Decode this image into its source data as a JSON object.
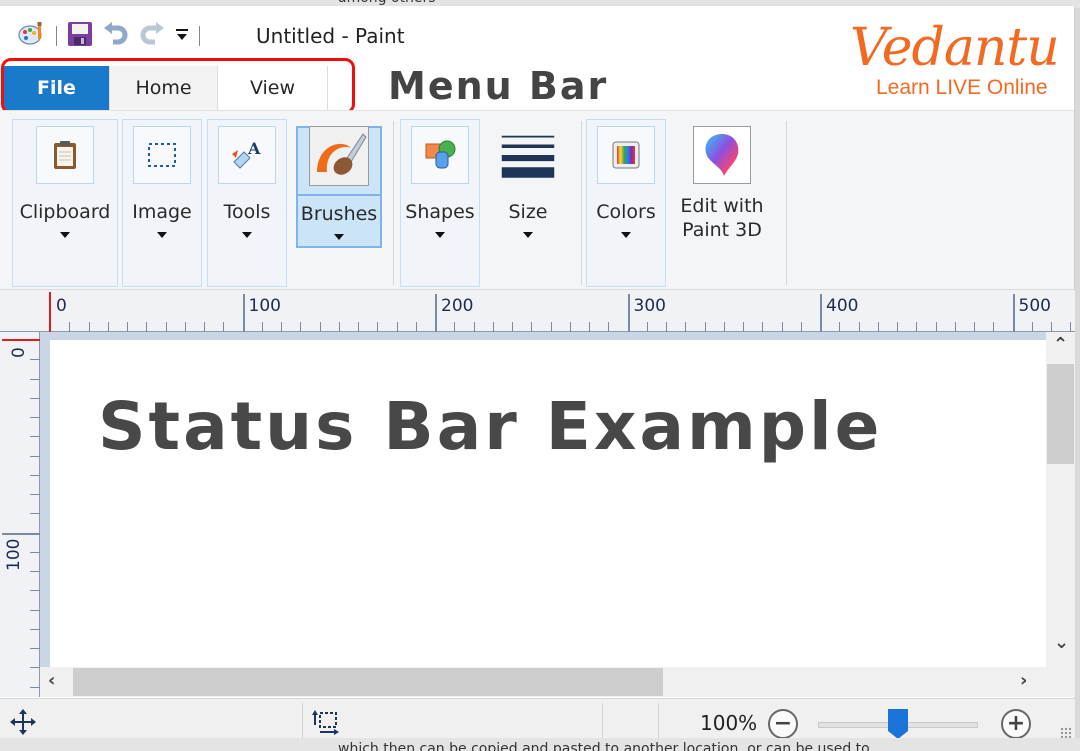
{
  "background": {
    "top_text": "among others",
    "bottom_text": "which then can be copied and pasted to another location, or can be used to"
  },
  "titlebar": {
    "title": "Untitled - Paint",
    "qat_icons": [
      "paint-app-icon",
      "save-icon",
      "undo-icon",
      "redo-icon",
      "customize-qat-icon"
    ]
  },
  "brand": {
    "logo": "Vedantu",
    "tagline": "Learn LIVE Online",
    "color": "#f26a21"
  },
  "tabs": [
    {
      "label": "File",
      "active": true
    },
    {
      "label": "Home",
      "active": false
    },
    {
      "label": "View",
      "active": false
    }
  ],
  "annotation": {
    "menu_bar_label": "Menu Bar",
    "highlight_color": "#f20d0d"
  },
  "ribbon": {
    "tools": [
      {
        "label": "Clipboard",
        "icon": "clipboard-icon",
        "dropdown": true
      },
      {
        "label": "Image",
        "icon": "select-icon",
        "dropdown": true
      },
      {
        "label": "Tools",
        "icon": "tools-icon",
        "dropdown": true
      },
      {
        "label": "Brushes",
        "icon": "brush-icon",
        "dropdown": true,
        "selected": true
      },
      {
        "label": "Shapes",
        "icon": "shapes-icon",
        "dropdown": true
      },
      {
        "label": "Size",
        "icon": "size-icon",
        "dropdown": true
      },
      {
        "label": "Colors",
        "icon": "colors-icon",
        "dropdown": true
      },
      {
        "label": "Edit with Paint 3D",
        "line1": "Edit with",
        "line2": "Paint 3D",
        "icon": "paint3d-icon",
        "dropdown": false
      }
    ]
  },
  "rulers": {
    "horizontal": [
      "0",
      "100",
      "200",
      "300",
      "400",
      "500"
    ],
    "vertical": [
      "0",
      "100"
    ]
  },
  "canvas": {
    "text": "Status Bar Example"
  },
  "statusbar": {
    "zoom_level": "100%",
    "zoom_slider_fraction": 0.5,
    "accent": "#1a73d9"
  }
}
